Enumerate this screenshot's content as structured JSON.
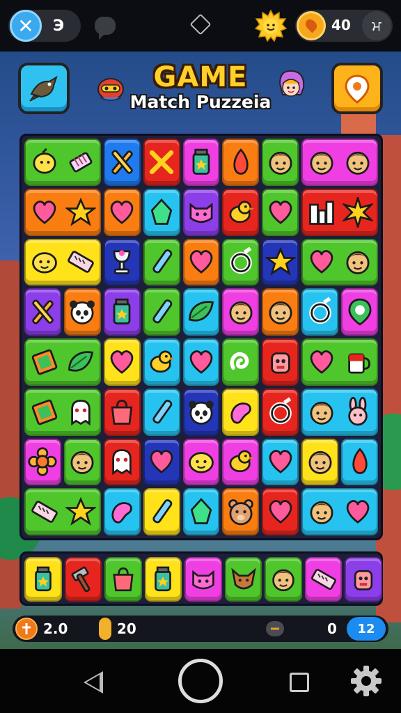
{
  "status_bar": {
    "close_count": "Э",
    "coins": "40",
    "close_icon": "close-x-icon",
    "chat_icon": "chat-bubble-icon",
    "diamond_icon": "diamond-icon",
    "sun_icon": "sun-icon",
    "coin_icon": "location-coin-icon",
    "swap_icon": "swap-icon",
    "swap_glyph": "ਮ"
  },
  "header": {
    "title": "GAME",
    "subtitle": "Match Puzzeia",
    "left_button_icon": "bird-icon",
    "right_button_icon": "location-pin-icon"
  },
  "colors": {
    "green": "#4fc62b",
    "red": "#e6261e",
    "blue": "#1f7bef",
    "cyan": "#27c3f0",
    "orange": "#fa7d12",
    "yellow": "#ffe21a",
    "magenta": "#ef3fe3",
    "purple": "#8c3ee8",
    "navy": "#2436b8",
    "pink": "#ff5bd0"
  },
  "board": {
    "rows": [
      [
        {
          "color": "green",
          "span": 2,
          "icons": [
            "lemon-icon",
            "brush-icon"
          ]
        },
        {
          "color": "blue",
          "span": 1,
          "icons": [
            "crossed-pencils-icon"
          ]
        },
        {
          "color": "red",
          "span": 1,
          "icons": [
            "x-mark-icon"
          ]
        },
        {
          "color": "magenta",
          "span": 1,
          "icons": [
            "jar-icon"
          ]
        },
        {
          "color": "orange",
          "span": 1,
          "icons": [
            "leaf-drop-icon"
          ]
        },
        {
          "color": "green",
          "span": 1,
          "icons": [
            "face-icon"
          ]
        },
        {
          "color": "magenta",
          "span": 2,
          "icons": [
            "face-icon",
            "face-icon"
          ]
        }
      ],
      [
        {
          "color": "orange",
          "span": 2,
          "icons": [
            "heart-icon",
            "star-icon"
          ]
        },
        {
          "color": "orange",
          "span": 1,
          "icons": [
            "heart-icon"
          ]
        },
        {
          "color": "cyan",
          "span": 1,
          "icons": [
            "crystal-icon"
          ]
        },
        {
          "color": "purple",
          "span": 1,
          "icons": [
            "cat-face-icon"
          ]
        },
        {
          "color": "red",
          "span": 1,
          "icons": [
            "bird-icon"
          ]
        },
        {
          "color": "green",
          "span": 1,
          "icons": [
            "heart-icon"
          ]
        },
        {
          "color": "red",
          "span": 2,
          "icons": [
            "city-icon",
            "burst-icon"
          ]
        }
      ],
      [
        {
          "color": "yellow",
          "span": 2,
          "icons": [
            "blob-face-icon",
            "ruler-icon"
          ]
        },
        {
          "color": "navy",
          "span": 1,
          "icons": [
            "goblet-icon"
          ]
        },
        {
          "color": "green",
          "span": 1,
          "icons": [
            "pencil-icon"
          ]
        },
        {
          "color": "orange",
          "span": 1,
          "icons": [
            "heart-icon"
          ]
        },
        {
          "color": "green",
          "span": 1,
          "icons": [
            "ring-icon"
          ]
        },
        {
          "color": "navy",
          "span": 1,
          "icons": [
            "star-icon"
          ]
        },
        {
          "color": "green",
          "span": 2,
          "icons": [
            "heart-icon",
            "face-icon"
          ]
        }
      ],
      [
        {
          "color": "purple",
          "span": 1,
          "icons": [
            "crossed-pencils-icon"
          ]
        },
        {
          "color": "orange",
          "span": 1,
          "icons": [
            "panda-face-icon"
          ]
        },
        {
          "color": "purple",
          "span": 1,
          "icons": [
            "jar-icon"
          ]
        },
        {
          "color": "green",
          "span": 1,
          "icons": [
            "pencil-icon"
          ]
        },
        {
          "color": "cyan",
          "span": 1,
          "icons": [
            "leaf-icon"
          ]
        },
        {
          "color": "magenta",
          "span": 1,
          "icons": [
            "face-icon"
          ]
        },
        {
          "color": "orange",
          "span": 1,
          "icons": [
            "face-icon"
          ]
        },
        {
          "color": "cyan",
          "span": 1,
          "icons": [
            "ring-icon"
          ]
        },
        {
          "color": "magenta",
          "span": 1,
          "icons": [
            "pin-icon"
          ]
        }
      ],
      [
        {
          "color": "green",
          "span": 2,
          "icons": [
            "book-icon",
            "leaf-icon"
          ]
        },
        {
          "color": "yellow",
          "span": 1,
          "icons": [
            "heart-icon"
          ]
        },
        {
          "color": "cyan",
          "span": 1,
          "icons": [
            "bird-icon"
          ]
        },
        {
          "color": "cyan",
          "span": 1,
          "icons": [
            "heart-icon"
          ]
        },
        {
          "color": "green",
          "span": 1,
          "icons": [
            "swirl-icon"
          ]
        },
        {
          "color": "red",
          "span": 1,
          "icons": [
            "robot-face-icon"
          ]
        },
        {
          "color": "green",
          "span": 2,
          "icons": [
            "heart-icon",
            "mug-icon"
          ]
        }
      ],
      [
        {
          "color": "green",
          "span": 2,
          "icons": [
            "book-icon",
            "ghost-icon"
          ]
        },
        {
          "color": "red",
          "span": 1,
          "icons": [
            "bag-icon"
          ]
        },
        {
          "color": "cyan",
          "span": 1,
          "icons": [
            "pencil-icon"
          ]
        },
        {
          "color": "navy",
          "span": 1,
          "icons": [
            "panda-face-icon"
          ]
        },
        {
          "color": "yellow",
          "span": 1,
          "icons": [
            "bean-icon"
          ]
        },
        {
          "color": "red",
          "span": 1,
          "icons": [
            "ring-icon"
          ]
        },
        {
          "color": "cyan",
          "span": 2,
          "icons": [
            "face-icon",
            "bunny-icon"
          ]
        }
      ],
      [
        {
          "color": "magenta",
          "span": 1,
          "icons": [
            "flower-icon"
          ]
        },
        {
          "color": "green",
          "span": 1,
          "icons": [
            "face-icon"
          ]
        },
        {
          "color": "red",
          "span": 1,
          "icons": [
            "ghost-icon"
          ]
        },
        {
          "color": "navy",
          "span": 1,
          "icons": [
            "heart-icon"
          ]
        },
        {
          "color": "magenta",
          "span": 1,
          "icons": [
            "blob-face-icon"
          ]
        },
        {
          "color": "magenta",
          "span": 1,
          "icons": [
            "bird-icon"
          ]
        },
        {
          "color": "cyan",
          "span": 1,
          "icons": [
            "heart-icon"
          ]
        },
        {
          "color": "yellow",
          "span": 1,
          "icons": [
            "face-icon"
          ]
        },
        {
          "color": "cyan",
          "span": 1,
          "icons": [
            "leaf-drop-icon"
          ]
        }
      ],
      [
        {
          "color": "green",
          "span": 2,
          "icons": [
            "ruler-icon",
            "star-icon"
          ]
        },
        {
          "color": "cyan",
          "span": 1,
          "icons": [
            "bean-icon"
          ]
        },
        {
          "color": "yellow",
          "span": 1,
          "icons": [
            "pencil-icon"
          ]
        },
        {
          "color": "cyan",
          "span": 1,
          "icons": [
            "crystal-icon"
          ]
        },
        {
          "color": "orange",
          "span": 1,
          "icons": [
            "bear-face-icon"
          ]
        },
        {
          "color": "red",
          "span": 1,
          "icons": [
            "heart-icon"
          ]
        },
        {
          "color": "cyan",
          "span": 2,
          "icons": [
            "face-icon",
            "heart-icon"
          ]
        }
      ]
    ]
  },
  "tray": [
    {
      "color": "yellow",
      "icon": "jar-icon"
    },
    {
      "color": "red",
      "icon": "hammer-icon"
    },
    {
      "color": "green",
      "icon": "bag-icon"
    },
    {
      "color": "yellow",
      "icon": "jar-icon"
    },
    {
      "color": "magenta",
      "icon": "cat-face-icon"
    },
    {
      "color": "green",
      "icon": "fox-face-icon"
    },
    {
      "color": "green",
      "icon": "face-icon"
    },
    {
      "color": "magenta",
      "icon": "ruler-icon"
    },
    {
      "color": "purple",
      "icon": "robot-face-icon"
    }
  ],
  "stats": {
    "moves": "2.0",
    "coins": "20",
    "score": "0",
    "level": "12",
    "moves_icon": "plus-badge-icon",
    "coin_icon": "coin-icon",
    "score_icon": "minus-icon"
  },
  "navbar": {
    "back_icon": "back-triangle-icon",
    "home_icon": "home-circle-icon",
    "recent_icon": "recent-square-icon",
    "settings_icon": "gear-icon"
  }
}
